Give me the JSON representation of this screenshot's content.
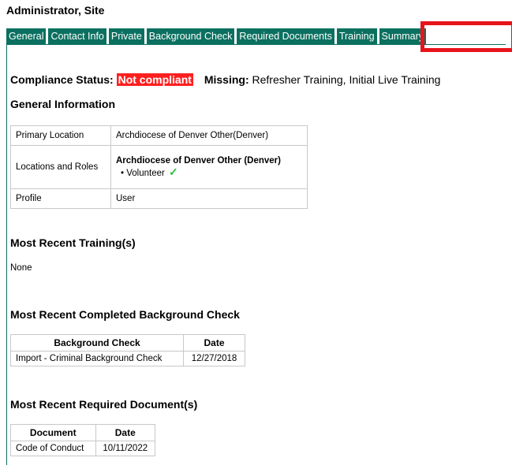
{
  "header": {
    "name": "Administrator, Site"
  },
  "tabs": [
    {
      "label": "General"
    },
    {
      "label": "Contact Info"
    },
    {
      "label": "Private"
    },
    {
      "label": "Background Check"
    },
    {
      "label": "Required Documents"
    },
    {
      "label": "Training"
    },
    {
      "label": "Summary"
    }
  ],
  "compliance": {
    "label": "Compliance Status:",
    "status": "Not compliant",
    "missing_label": "Missing:",
    "missing_items": "Refresher Training, Initial Live Training",
    "status_color": "#ff1f1f"
  },
  "general_info": {
    "title": "General Information",
    "primary_location_label": "Primary Location",
    "primary_location_value": "Archdiocese of Denver Other(Denver)",
    "locations_roles_label": "Locations and Roles",
    "location_name": "Archdiocese of Denver Other (Denver)",
    "role": "• Volunteer",
    "role_status_icon": "checkmark-icon",
    "profile_label": "Profile",
    "profile_value": "User"
  },
  "training": {
    "title": "Most Recent Training(s)",
    "value": "None"
  },
  "background_check": {
    "title": "Most Recent Completed Background Check",
    "headers": [
      "Background Check",
      "Date"
    ],
    "rows": [
      [
        "Import - Criminal Background Check",
        "12/27/2018"
      ]
    ]
  },
  "documents": {
    "title": "Most Recent Required Document(s)",
    "headers": [
      "Document",
      "Date"
    ],
    "rows": [
      [
        "Code of Conduct",
        "10/11/2022"
      ]
    ]
  },
  "colors": {
    "tab_bg": "#0b7060",
    "highlight": "#e8141b",
    "check": "#27c23b"
  }
}
